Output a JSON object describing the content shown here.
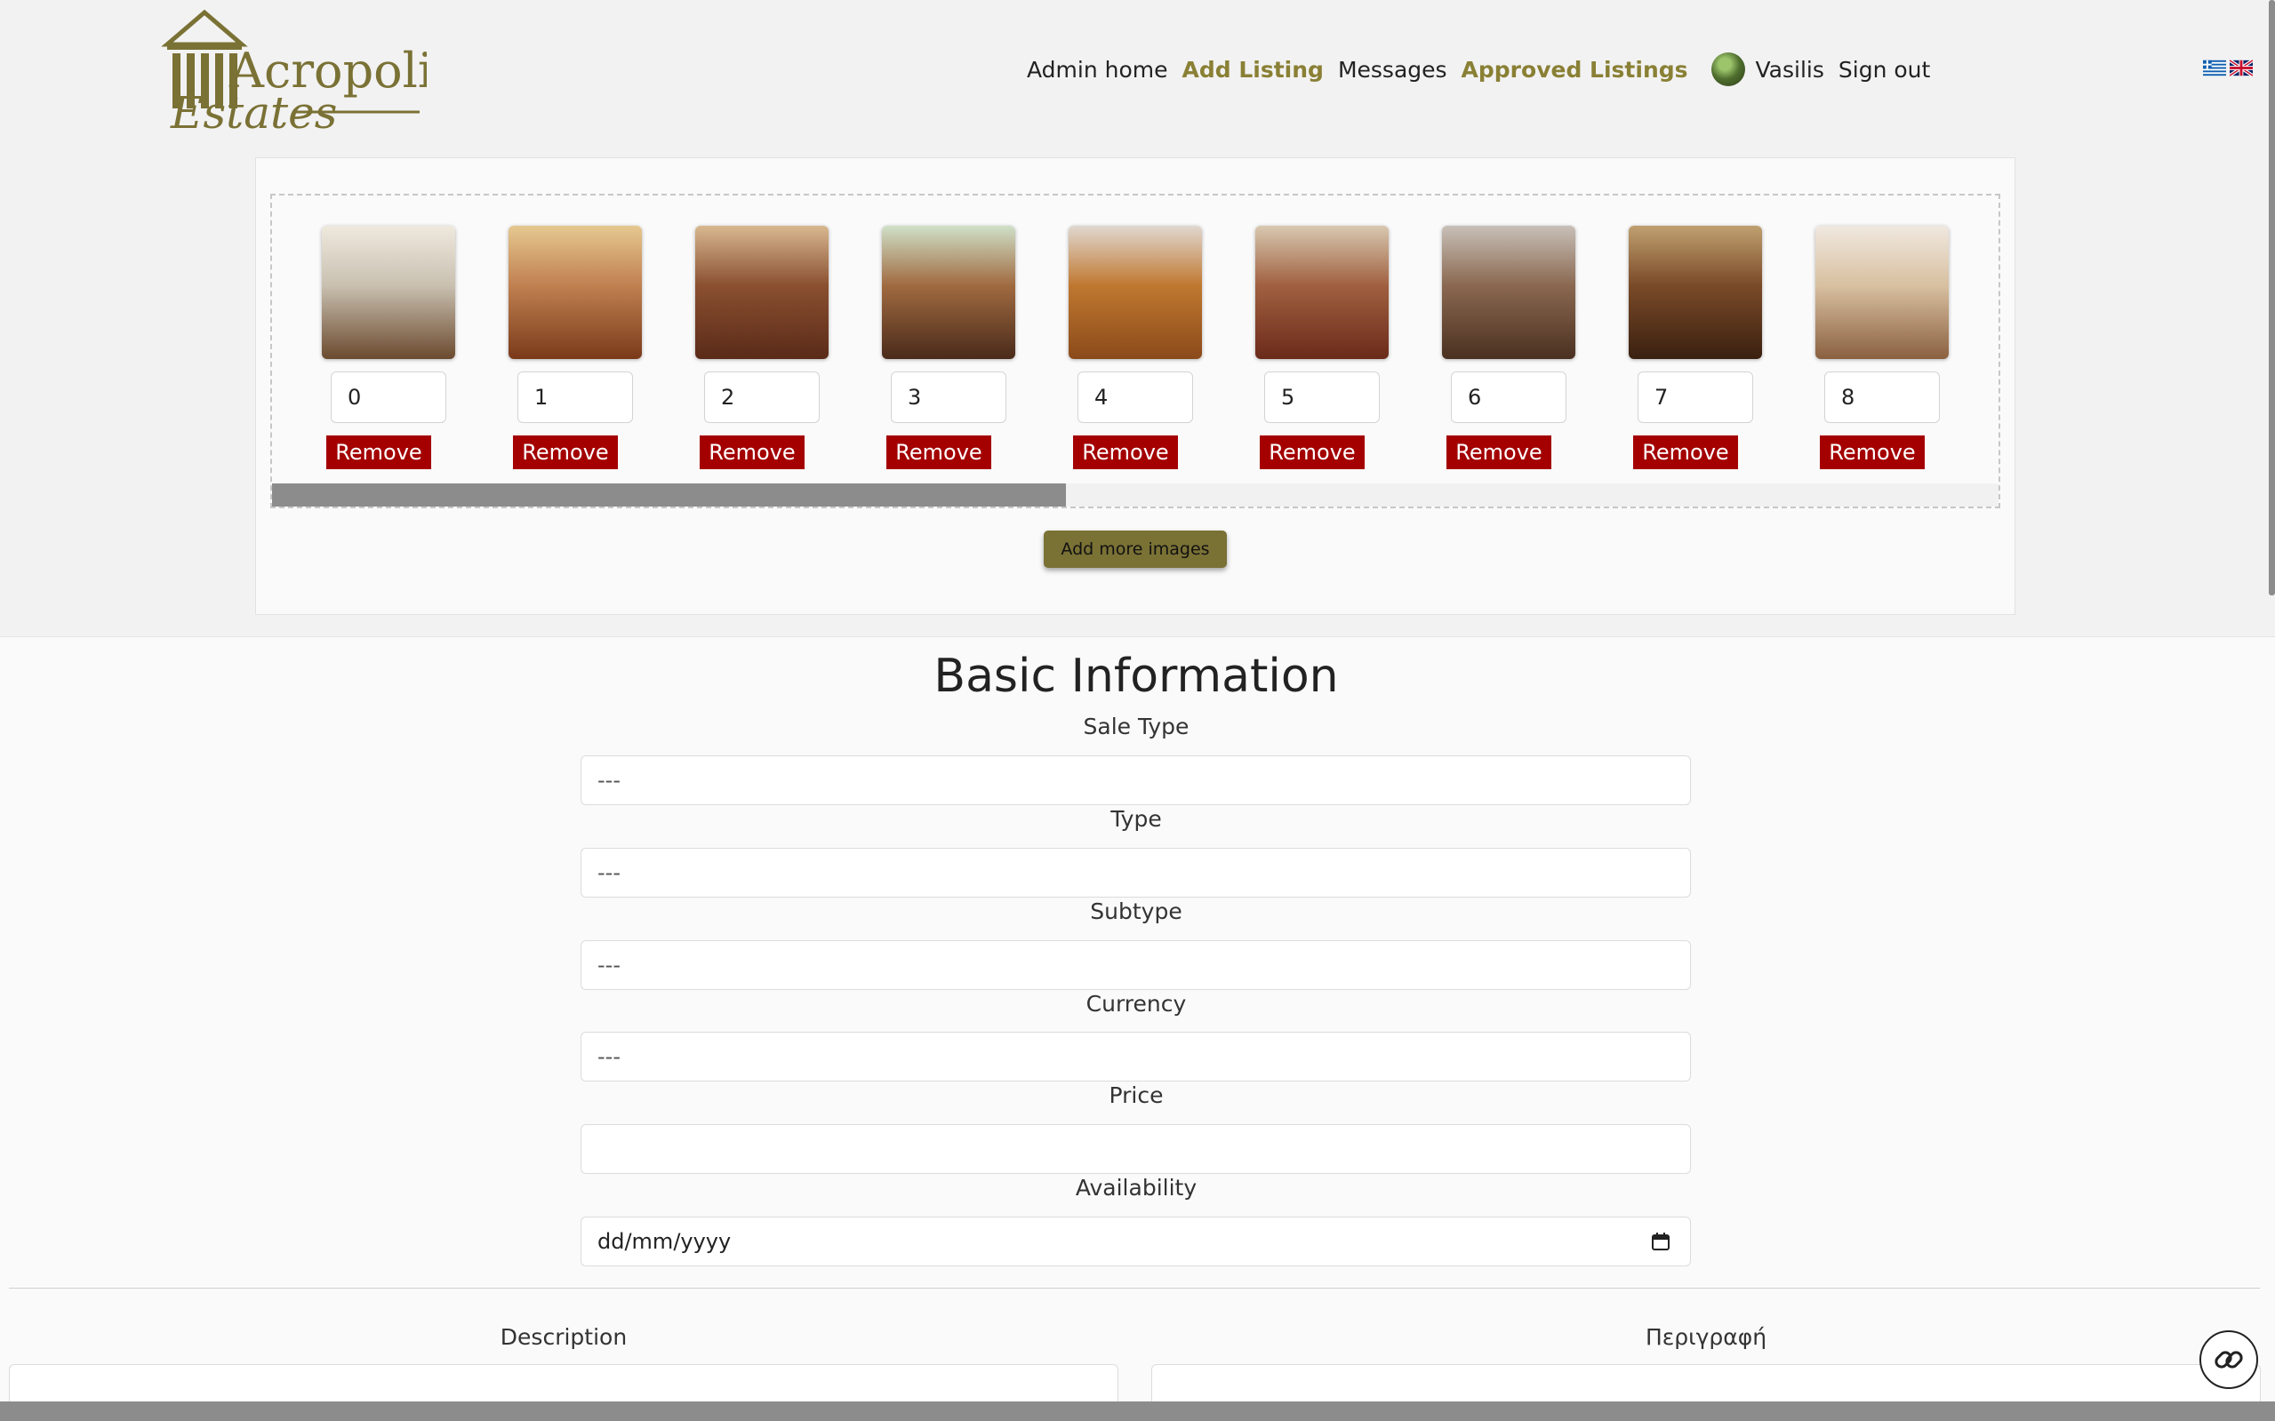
{
  "brand": {
    "name_line1": "Acropolis",
    "name_line2": "Estates",
    "logo_color": "#7a7135"
  },
  "nav": {
    "admin_home": "Admin home",
    "add_listing": "Add Listing",
    "messages": "Messages",
    "approved_listings": "Approved Listings",
    "user_name": "Vasilis",
    "sign_out": "Sign out",
    "accent_color": "#8a8035"
  },
  "languages": [
    "greek-flag-icon",
    "uk-flag-icon"
  ],
  "images": {
    "items": [
      {
        "order": "0",
        "remove_label": "Remove"
      },
      {
        "order": "1",
        "remove_label": "Remove"
      },
      {
        "order": "2",
        "remove_label": "Remove"
      },
      {
        "order": "3",
        "remove_label": "Remove"
      },
      {
        "order": "4",
        "remove_label": "Remove"
      },
      {
        "order": "5",
        "remove_label": "Remove"
      },
      {
        "order": "6",
        "remove_label": "Remove"
      },
      {
        "order": "7",
        "remove_label": "Remove"
      },
      {
        "order": "8",
        "remove_label": "Remove"
      }
    ],
    "add_more_label": "Add more images",
    "remove_color": "#a40000",
    "add_button_color": "#7a7135"
  },
  "basic_info": {
    "title": "Basic Information",
    "sale_type": {
      "label": "Sale Type",
      "value": "---"
    },
    "type": {
      "label": "Type",
      "value": "---"
    },
    "subtype": {
      "label": "Subtype",
      "value": "---"
    },
    "currency": {
      "label": "Currency",
      "value": "---"
    },
    "price": {
      "label": "Price",
      "value": ""
    },
    "availability": {
      "label": "Availability",
      "placeholder": "dd/mm/yyyy"
    }
  },
  "description": {
    "label_en": "Description",
    "label_gr": "Περιγραφή"
  },
  "floating": {
    "icon": "link-icon"
  }
}
